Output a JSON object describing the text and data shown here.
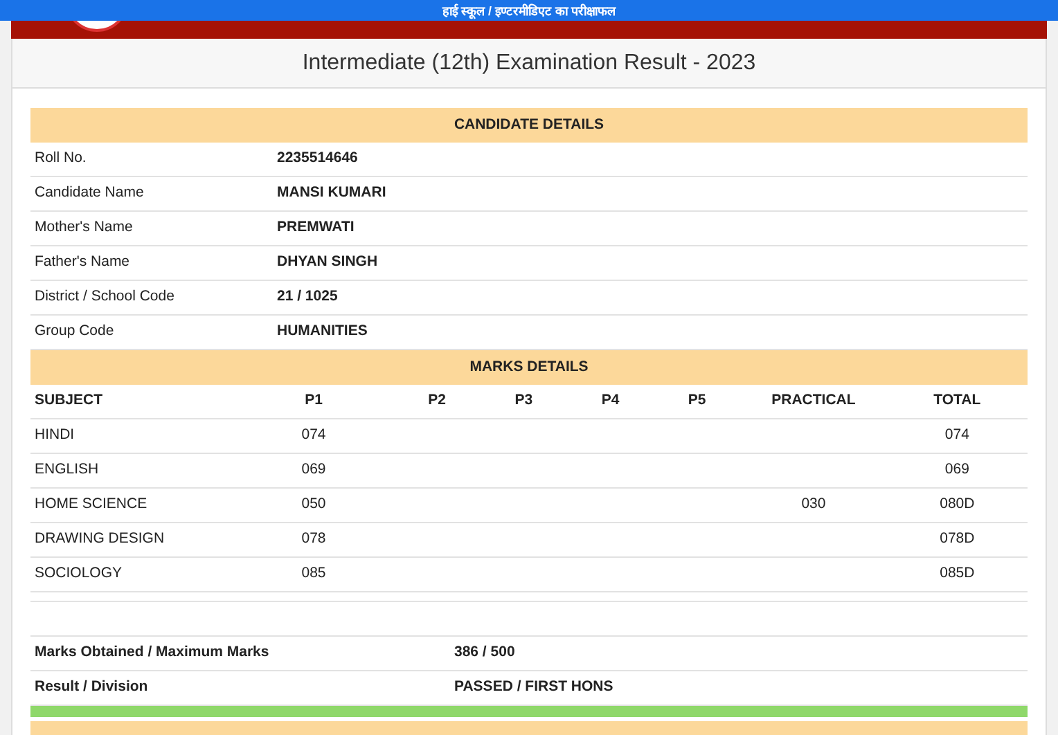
{
  "banner": {
    "text": "हाई स्कूल / इण्टरमीडिएट का परीक्षाफल"
  },
  "title": "Intermediate (12th) Examination Result - 2023",
  "candidate": {
    "heading": "CANDIDATE DETAILS",
    "rows": [
      {
        "label": "Roll No.",
        "value": "2235514646"
      },
      {
        "label": "Candidate Name",
        "value": "MANSI KUMARI"
      },
      {
        "label": "Mother's Name",
        "value": "PREMWATI"
      },
      {
        "label": "Father's Name",
        "value": "DHYAN SINGH"
      },
      {
        "label": "District / School Code",
        "value": "21 / 1025"
      },
      {
        "label": "Group Code",
        "value": "HUMANITIES"
      }
    ]
  },
  "marks": {
    "heading": "MARKS DETAILS",
    "columns": [
      "SUBJECT",
      "P1",
      "P2",
      "P3",
      "P4",
      "P5",
      "PRACTICAL",
      "TOTAL"
    ],
    "rows": [
      [
        "HINDI",
        "074",
        "",
        "",
        "",
        "",
        "",
        "074"
      ],
      [
        "ENGLISH",
        "069",
        "",
        "",
        "",
        "",
        "",
        "069"
      ],
      [
        "HOME SCIENCE",
        "050",
        "",
        "",
        "",
        "",
        "030",
        "080D"
      ],
      [
        "DRAWING DESIGN",
        "078",
        "",
        "",
        "",
        "",
        "",
        "078D"
      ],
      [
        "SOCIOLOGY",
        "085",
        "",
        "",
        "",
        "",
        "",
        "085D"
      ]
    ]
  },
  "summary": [
    {
      "label": "Marks Obtained / Maximum Marks",
      "value": "386 / 500"
    },
    {
      "label": "Result / Division",
      "value": "PASSED / FIRST HONS"
    }
  ]
}
